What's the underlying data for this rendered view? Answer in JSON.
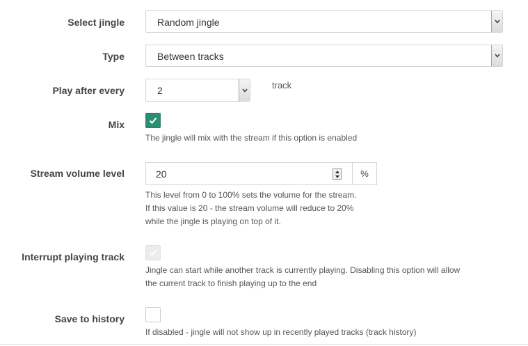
{
  "form": {
    "select_jingle": {
      "label": "Select jingle",
      "value": "Random jingle",
      "icon": "chevron-down-icon"
    },
    "type": {
      "label": "Type",
      "value": "Between tracks",
      "icon": "chevron-down-icon"
    },
    "play_after_every": {
      "label": "Play after every",
      "value": "2",
      "unit": "track",
      "icon": "chevron-down-icon"
    },
    "mix": {
      "label": "Mix",
      "checked": true,
      "help": "The jingle will mix with the stream if this option is enabled",
      "accent_color": "#2a8f70"
    },
    "stream_volume": {
      "label": "Stream volume level",
      "value": "20",
      "addon": "%",
      "help_lines": [
        "This level from 0 to 100% sets the volume for the stream.",
        "If this value is 20 - the stream volume will reduce to 20%",
        "while the jingle is playing on top of it."
      ]
    },
    "interrupt": {
      "label": "Interrupt playing track",
      "checked": true,
      "disabled": true,
      "help_lines": [
        "Jingle can start while another track is currently playing. Disabling this option will allow",
        "the current track to finish playing up to the end"
      ]
    },
    "history": {
      "label": "Save to history",
      "checked": false,
      "help": "If disabled - jingle will not show up in recently played tracks (track history)"
    }
  }
}
